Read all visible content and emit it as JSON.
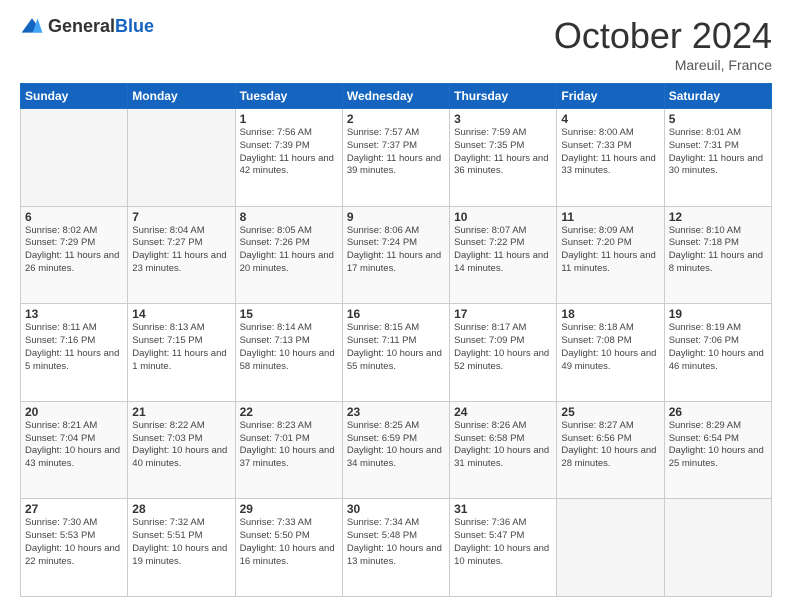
{
  "logo": {
    "general": "General",
    "blue": "Blue"
  },
  "title": "October 2024",
  "location": "Mareuil, France",
  "days_header": [
    "Sunday",
    "Monday",
    "Tuesday",
    "Wednesday",
    "Thursday",
    "Friday",
    "Saturday"
  ],
  "weeks": [
    [
      {
        "day": "",
        "details": ""
      },
      {
        "day": "",
        "details": ""
      },
      {
        "day": "1",
        "details": "Sunrise: 7:56 AM\nSunset: 7:39 PM\nDaylight: 11 hours\nand 42 minutes."
      },
      {
        "day": "2",
        "details": "Sunrise: 7:57 AM\nSunset: 7:37 PM\nDaylight: 11 hours\nand 39 minutes."
      },
      {
        "day": "3",
        "details": "Sunrise: 7:59 AM\nSunset: 7:35 PM\nDaylight: 11 hours\nand 36 minutes."
      },
      {
        "day": "4",
        "details": "Sunrise: 8:00 AM\nSunset: 7:33 PM\nDaylight: 11 hours\nand 33 minutes."
      },
      {
        "day": "5",
        "details": "Sunrise: 8:01 AM\nSunset: 7:31 PM\nDaylight: 11 hours\nand 30 minutes."
      }
    ],
    [
      {
        "day": "6",
        "details": "Sunrise: 8:02 AM\nSunset: 7:29 PM\nDaylight: 11 hours\nand 26 minutes."
      },
      {
        "day": "7",
        "details": "Sunrise: 8:04 AM\nSunset: 7:27 PM\nDaylight: 11 hours\nand 23 minutes."
      },
      {
        "day": "8",
        "details": "Sunrise: 8:05 AM\nSunset: 7:26 PM\nDaylight: 11 hours\nand 20 minutes."
      },
      {
        "day": "9",
        "details": "Sunrise: 8:06 AM\nSunset: 7:24 PM\nDaylight: 11 hours\nand 17 minutes."
      },
      {
        "day": "10",
        "details": "Sunrise: 8:07 AM\nSunset: 7:22 PM\nDaylight: 11 hours\nand 14 minutes."
      },
      {
        "day": "11",
        "details": "Sunrise: 8:09 AM\nSunset: 7:20 PM\nDaylight: 11 hours\nand 11 minutes."
      },
      {
        "day": "12",
        "details": "Sunrise: 8:10 AM\nSunset: 7:18 PM\nDaylight: 11 hours\nand 8 minutes."
      }
    ],
    [
      {
        "day": "13",
        "details": "Sunrise: 8:11 AM\nSunset: 7:16 PM\nDaylight: 11 hours\nand 5 minutes."
      },
      {
        "day": "14",
        "details": "Sunrise: 8:13 AM\nSunset: 7:15 PM\nDaylight: 11 hours\nand 1 minute."
      },
      {
        "day": "15",
        "details": "Sunrise: 8:14 AM\nSunset: 7:13 PM\nDaylight: 10 hours\nand 58 minutes."
      },
      {
        "day": "16",
        "details": "Sunrise: 8:15 AM\nSunset: 7:11 PM\nDaylight: 10 hours\nand 55 minutes."
      },
      {
        "day": "17",
        "details": "Sunrise: 8:17 AM\nSunset: 7:09 PM\nDaylight: 10 hours\nand 52 minutes."
      },
      {
        "day": "18",
        "details": "Sunrise: 8:18 AM\nSunset: 7:08 PM\nDaylight: 10 hours\nand 49 minutes."
      },
      {
        "day": "19",
        "details": "Sunrise: 8:19 AM\nSunset: 7:06 PM\nDaylight: 10 hours\nand 46 minutes."
      }
    ],
    [
      {
        "day": "20",
        "details": "Sunrise: 8:21 AM\nSunset: 7:04 PM\nDaylight: 10 hours\nand 43 minutes."
      },
      {
        "day": "21",
        "details": "Sunrise: 8:22 AM\nSunset: 7:03 PM\nDaylight: 10 hours\nand 40 minutes."
      },
      {
        "day": "22",
        "details": "Sunrise: 8:23 AM\nSunset: 7:01 PM\nDaylight: 10 hours\nand 37 minutes."
      },
      {
        "day": "23",
        "details": "Sunrise: 8:25 AM\nSunset: 6:59 PM\nDaylight: 10 hours\nand 34 minutes."
      },
      {
        "day": "24",
        "details": "Sunrise: 8:26 AM\nSunset: 6:58 PM\nDaylight: 10 hours\nand 31 minutes."
      },
      {
        "day": "25",
        "details": "Sunrise: 8:27 AM\nSunset: 6:56 PM\nDaylight: 10 hours\nand 28 minutes."
      },
      {
        "day": "26",
        "details": "Sunrise: 8:29 AM\nSunset: 6:54 PM\nDaylight: 10 hours\nand 25 minutes."
      }
    ],
    [
      {
        "day": "27",
        "details": "Sunrise: 7:30 AM\nSunset: 5:53 PM\nDaylight: 10 hours\nand 22 minutes."
      },
      {
        "day": "28",
        "details": "Sunrise: 7:32 AM\nSunset: 5:51 PM\nDaylight: 10 hours\nand 19 minutes."
      },
      {
        "day": "29",
        "details": "Sunrise: 7:33 AM\nSunset: 5:50 PM\nDaylight: 10 hours\nand 16 minutes."
      },
      {
        "day": "30",
        "details": "Sunrise: 7:34 AM\nSunset: 5:48 PM\nDaylight: 10 hours\nand 13 minutes."
      },
      {
        "day": "31",
        "details": "Sunrise: 7:36 AM\nSunset: 5:47 PM\nDaylight: 10 hours\nand 10 minutes."
      },
      {
        "day": "",
        "details": ""
      },
      {
        "day": "",
        "details": ""
      }
    ]
  ]
}
